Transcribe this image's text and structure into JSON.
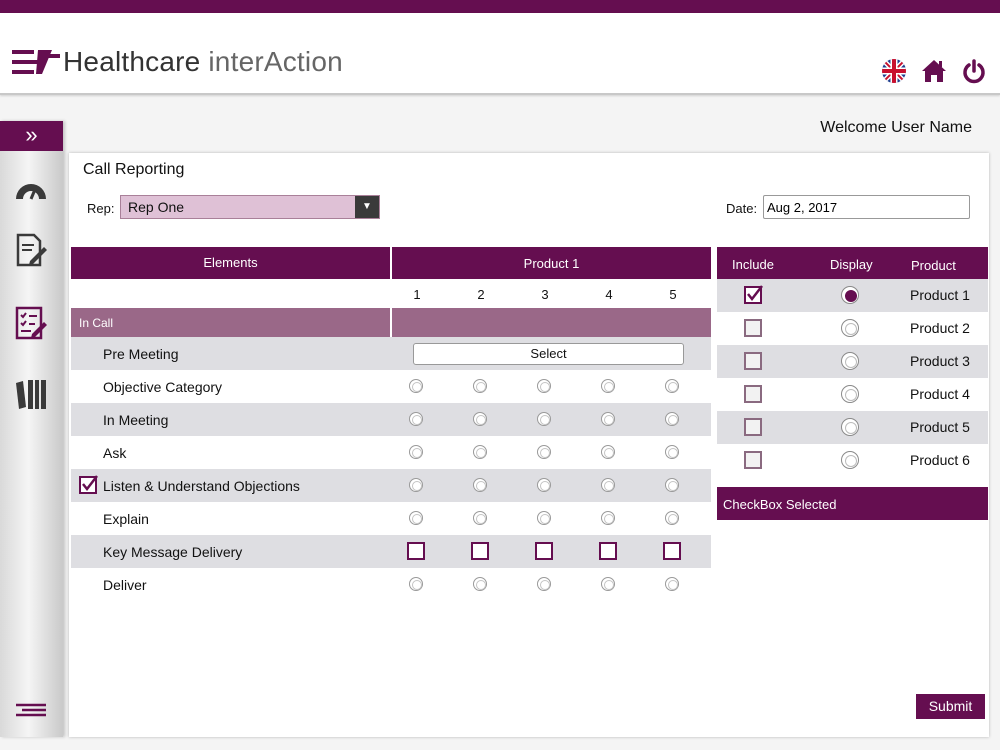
{
  "app": {
    "logo_text_bold": "Healthcare",
    "logo_text_light": "interAction",
    "brand_color": "#650e50"
  },
  "header_icons": [
    "uk-flag-icon",
    "home-icon",
    "power-icon"
  ],
  "sidebar": {
    "toggle_glyph": "»",
    "items": [
      "dashboard-gauge-icon",
      "document-edit-icon",
      "checklist-icon",
      "library-books-icon",
      "menu-lines-icon"
    ]
  },
  "welcome": "Welcome User Name",
  "form": {
    "title": "Call Reporting",
    "rep_label": "Rep:",
    "rep_value": "Rep One",
    "date_label": "Date:",
    "date_value": "Aug 2, 2017"
  },
  "grid": {
    "elements_header": "Elements",
    "product_header": "Product 1",
    "scale": [
      "1",
      "2",
      "3",
      "4",
      "5"
    ],
    "section_label": "In Call",
    "select_label": "Select",
    "rows": [
      {
        "label": "Pre Meeting",
        "input": "select",
        "checked": false
      },
      {
        "label": "Objective Category",
        "input": "radio",
        "checked": false
      },
      {
        "label": "In Meeting",
        "input": "radio",
        "checked": false
      },
      {
        "label": "Ask",
        "input": "radio",
        "checked": false
      },
      {
        "label": "Listen & Understand Objections",
        "input": "radio",
        "checked": true
      },
      {
        "label": "Explain",
        "input": "radio",
        "checked": false
      },
      {
        "label": "Key Message Delivery",
        "input": "checkbox",
        "checked": false
      },
      {
        "label": "Deliver",
        "input": "radio",
        "checked": false
      }
    ]
  },
  "products": {
    "include_header": "Include",
    "display_header": "Display",
    "product_header": "Product",
    "items": [
      {
        "label": "Product 1",
        "include": true,
        "display": true
      },
      {
        "label": "Product 2",
        "include": false,
        "display": false
      },
      {
        "label": "Product 3",
        "include": false,
        "display": false
      },
      {
        "label": "Product 4",
        "include": false,
        "display": false
      },
      {
        "label": "Product 5",
        "include": false,
        "display": false
      },
      {
        "label": "Product 6",
        "include": false,
        "display": false
      }
    ],
    "checkbox_selected_label": "CheckBox Selected"
  },
  "submit_label": "Submit"
}
